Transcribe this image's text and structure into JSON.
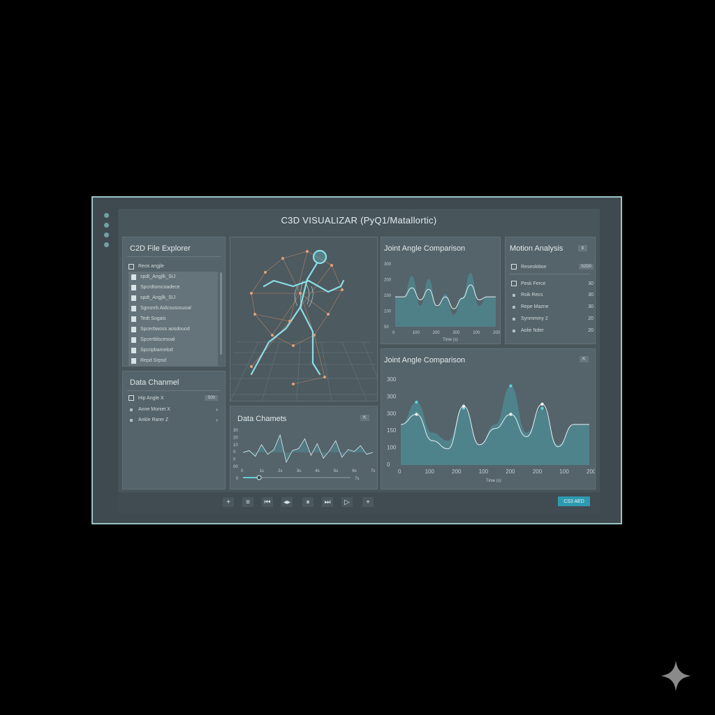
{
  "app": {
    "title": "C3D VISUALIZAR (PyQ1/Matallortic)"
  },
  "file_explorer": {
    "title": "C2D File Explorer",
    "items": [
      {
        "label": "Reos angjle",
        "type": "checkbox"
      },
      {
        "label": "spdt_Angjlk_SIJ",
        "type": "file"
      },
      {
        "label": "Spcrdtomcoadece",
        "type": "file"
      },
      {
        "label": "spdt_Angjlk_SIJ",
        "type": "file"
      },
      {
        "label": "Sgnsnrb Aidcsusosuoal",
        "type": "file"
      },
      {
        "label": "Tedt Sogais",
        "type": "file"
      },
      {
        "label": "Spcerbwoss aosdouod",
        "type": "file"
      },
      {
        "label": "Spcertblscesoal",
        "type": "file"
      },
      {
        "label": "Spcripbamelod",
        "type": "file"
      },
      {
        "label": "Repd Srpsd",
        "type": "file"
      }
    ]
  },
  "data_channel_panel": {
    "title": "Data Chanmel",
    "items": [
      {
        "label": "Hip Angle X",
        "value": "S00"
      },
      {
        "label": "Anne Moniet X",
        "value": ""
      },
      {
        "label": "Ankle Rarer Z",
        "value": ""
      }
    ]
  },
  "viewport": {
    "label": "3D skeleton viewport",
    "icon": "running-skeleton-icon"
  },
  "data_channels_chart": {
    "title": "Data Chamets",
    "playback": {
      "start": "0",
      "end": "7s",
      "progress": 0.15
    }
  },
  "joint_angle_small": {
    "title": "Joint Angle Comparison",
    "xlabel": "Time (s)"
  },
  "motion_analysis": {
    "title": "Motion Analysis",
    "header_badge": "⇕",
    "top_row": {
      "label": "Reseokition",
      "value": "S2D0"
    },
    "rows": [
      {
        "label": "Pesk Ferce",
        "value": "30"
      },
      {
        "label": "Rsik Recs",
        "value": "30"
      },
      {
        "label": "Repe Mazne",
        "value": "30"
      },
      {
        "label": "Synmmmy 2",
        "value": "20"
      },
      {
        "label": "Aolie Nder",
        "value": "20"
      }
    ]
  },
  "joint_angle_large": {
    "title": "Joint Angle Comparison",
    "xlabel": "Time (s)"
  },
  "controls": {
    "buttons": [
      "+",
      "≡",
      "⏮",
      "◂▸",
      "⏸",
      "⏭",
      "▷",
      "+"
    ],
    "export_label": "CS3 AED"
  },
  "colors": {
    "accent": "#2e9ab0",
    "teal_line": "#5fd0d6",
    "bone": "#8fe6ee",
    "joint": "#e09a6a"
  },
  "chart_data": [
    {
      "type": "area",
      "title": "Joint Angle Comparison",
      "xlabel": "Time (s)",
      "x_ticks": [
        "0",
        "100",
        "200",
        "300",
        "100",
        "200"
      ],
      "y_ticks": [
        "300",
        "200",
        "150",
        "100",
        "50"
      ],
      "series": [
        {
          "values": [
            150,
            150,
            220,
            120,
            210,
            115,
            160,
            90,
            150,
            230,
            120,
            150,
            150
          ]
        },
        {
          "values": [
            150,
            150,
            180,
            140,
            175,
            120,
            150,
            110,
            145,
            190,
            140,
            150,
            150
          ]
        }
      ]
    },
    {
      "type": "area",
      "title": "Joint Angle Comparison",
      "xlabel": "Time (s)",
      "x_ticks": [
        "0",
        "100",
        "200",
        "100",
        "200",
        "200",
        "100",
        "200"
      ],
      "y_ticks": [
        "300",
        "300",
        "300",
        "150",
        "100",
        "0"
      ],
      "series": [
        {
          "values": [
            150,
            205,
            130,
            110,
            190,
            100,
            150,
            245,
            130,
            190,
            100,
            150,
            150
          ]
        },
        {
          "values": [
            150,
            175,
            110,
            90,
            195,
            100,
            140,
            175,
            120,
            200,
            95,
            150,
            150
          ]
        }
      ]
    },
    {
      "type": "line",
      "title": "Data Chamets",
      "y_ticks": [
        "30",
        "20",
        "10",
        "0",
        "0",
        "00"
      ],
      "x_ticks": [
        "0",
        "1s",
        "2s",
        "3s",
        "4s",
        "5s",
        "6s",
        "7s"
      ],
      "series": [
        {
          "values": [
            0,
            2,
            -4,
            8,
            -2,
            3,
            18,
            -10,
            2,
            4,
            14,
            -3,
            9,
            -6,
            2,
            12,
            -5,
            3,
            1,
            7,
            -2,
            0
          ]
        }
      ]
    }
  ]
}
